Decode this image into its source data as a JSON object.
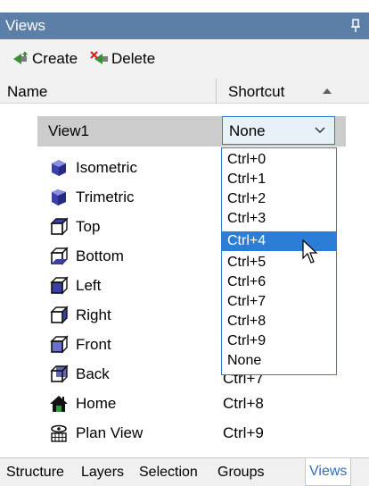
{
  "panel": {
    "title": "Views"
  },
  "toolbar": {
    "create_label": "Create",
    "delete_label": "Delete"
  },
  "columns": {
    "name": "Name",
    "shortcut": "Shortcut"
  },
  "view": {
    "name": "View1",
    "shortcut_value": "None"
  },
  "items": [
    {
      "label": "Isometric",
      "shortcut": "",
      "icon": "isometric-cube-icon"
    },
    {
      "label": "Trimetric",
      "shortcut": "",
      "icon": "trimetric-cube-icon"
    },
    {
      "label": "Top",
      "shortcut": "",
      "icon": "top-view-icon"
    },
    {
      "label": "Bottom",
      "shortcut": "",
      "icon": "bottom-view-icon"
    },
    {
      "label": "Left",
      "shortcut": "",
      "icon": "left-view-icon"
    },
    {
      "label": "Right",
      "shortcut": "",
      "icon": "right-view-icon"
    },
    {
      "label": "Front",
      "shortcut": "",
      "icon": "front-view-icon"
    },
    {
      "label": "Back",
      "shortcut": "Ctrl+7",
      "icon": "back-view-icon"
    },
    {
      "label": "Home",
      "shortcut": "Ctrl+8",
      "icon": "home-icon"
    },
    {
      "label": "Plan View",
      "shortcut": "Ctrl+9",
      "icon": "plan-view-icon"
    }
  ],
  "dropdown": {
    "options": [
      "Ctrl+0",
      "Ctrl+1",
      "Ctrl+2",
      "Ctrl+3",
      "Ctrl+4",
      "Ctrl+5",
      "Ctrl+6",
      "Ctrl+7",
      "Ctrl+8",
      "Ctrl+9",
      "None"
    ],
    "highlighted": "Ctrl+4"
  },
  "tabs": [
    "Structure",
    "Layers",
    "Selection",
    "Groups",
    "Views"
  ],
  "active_tab": "Views",
  "colors": {
    "header": "#5b7fa6",
    "accent": "#2c7dd6",
    "selected_row": "#cccccc"
  }
}
